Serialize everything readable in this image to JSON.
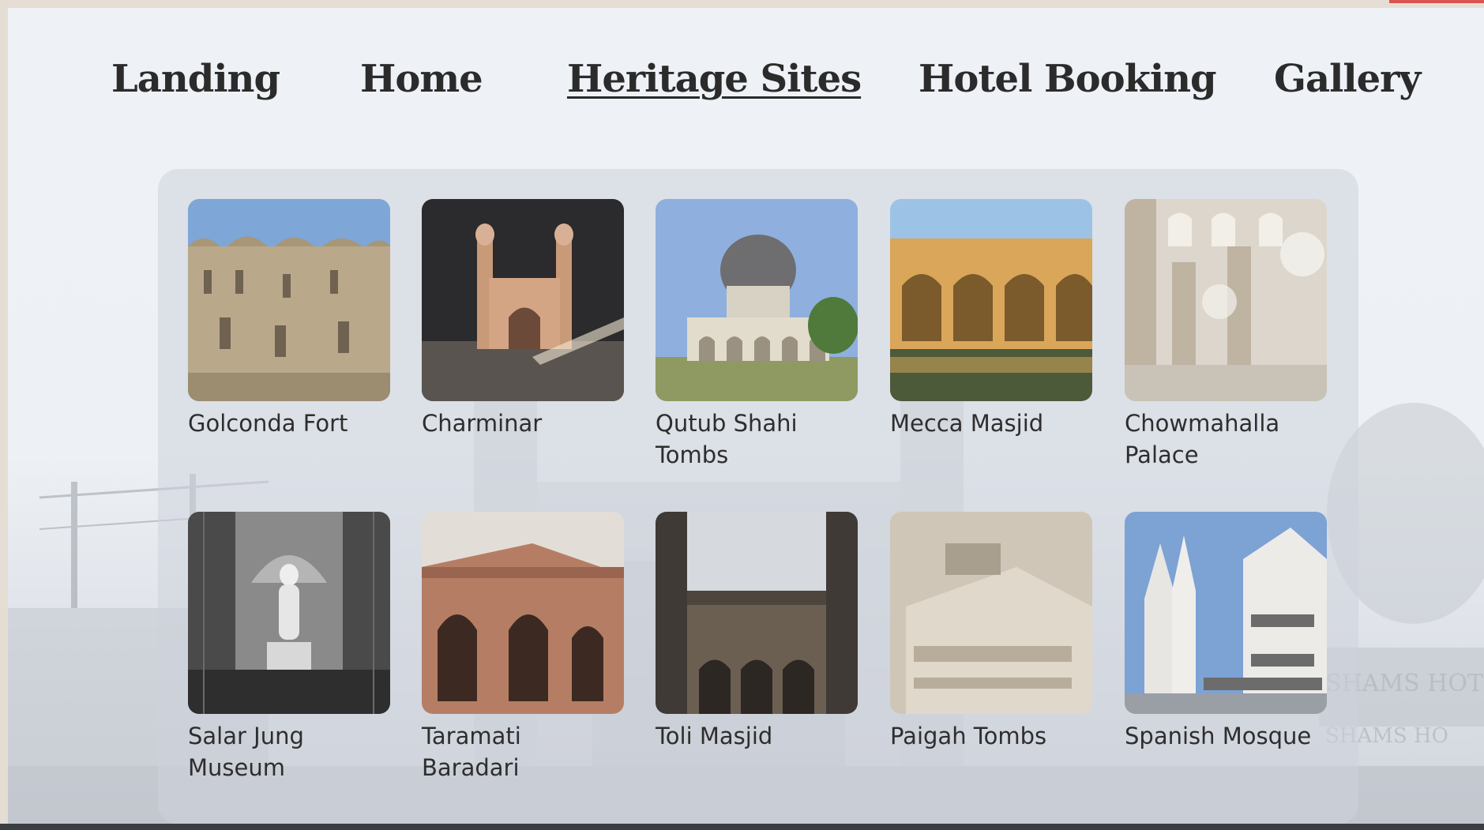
{
  "nav": {
    "items": [
      "Landing",
      "Home",
      "Heritage Sites",
      "Hotel Booking",
      "Gallery"
    ],
    "active": "Heritage Sites"
  },
  "sites": [
    {
      "name": "Golconda Fort",
      "icon": "fort-photo"
    },
    {
      "name": "Charminar",
      "icon": "charminar-photo"
    },
    {
      "name": "Qutub Shahi Tombs",
      "icon": "tomb-dome-photo"
    },
    {
      "name": "Mecca Masjid",
      "icon": "mosque-arches-photo"
    },
    {
      "name": "Chowmahalla Palace",
      "icon": "palace-hall-photo"
    },
    {
      "name": "Salar Jung Museum",
      "icon": "statue-photo"
    },
    {
      "name": "Taramati Baradari",
      "icon": "pavilion-photo"
    },
    {
      "name": "Toli Masjid",
      "icon": "minarets-photo"
    },
    {
      "name": "Paigah Tombs",
      "icon": "marble-tomb-photo"
    },
    {
      "name": "Spanish Mosque",
      "icon": "spires-photo"
    }
  ],
  "background": {
    "signage": [
      "SHAMS HOTEL",
      "SHAMS HO"
    ]
  }
}
